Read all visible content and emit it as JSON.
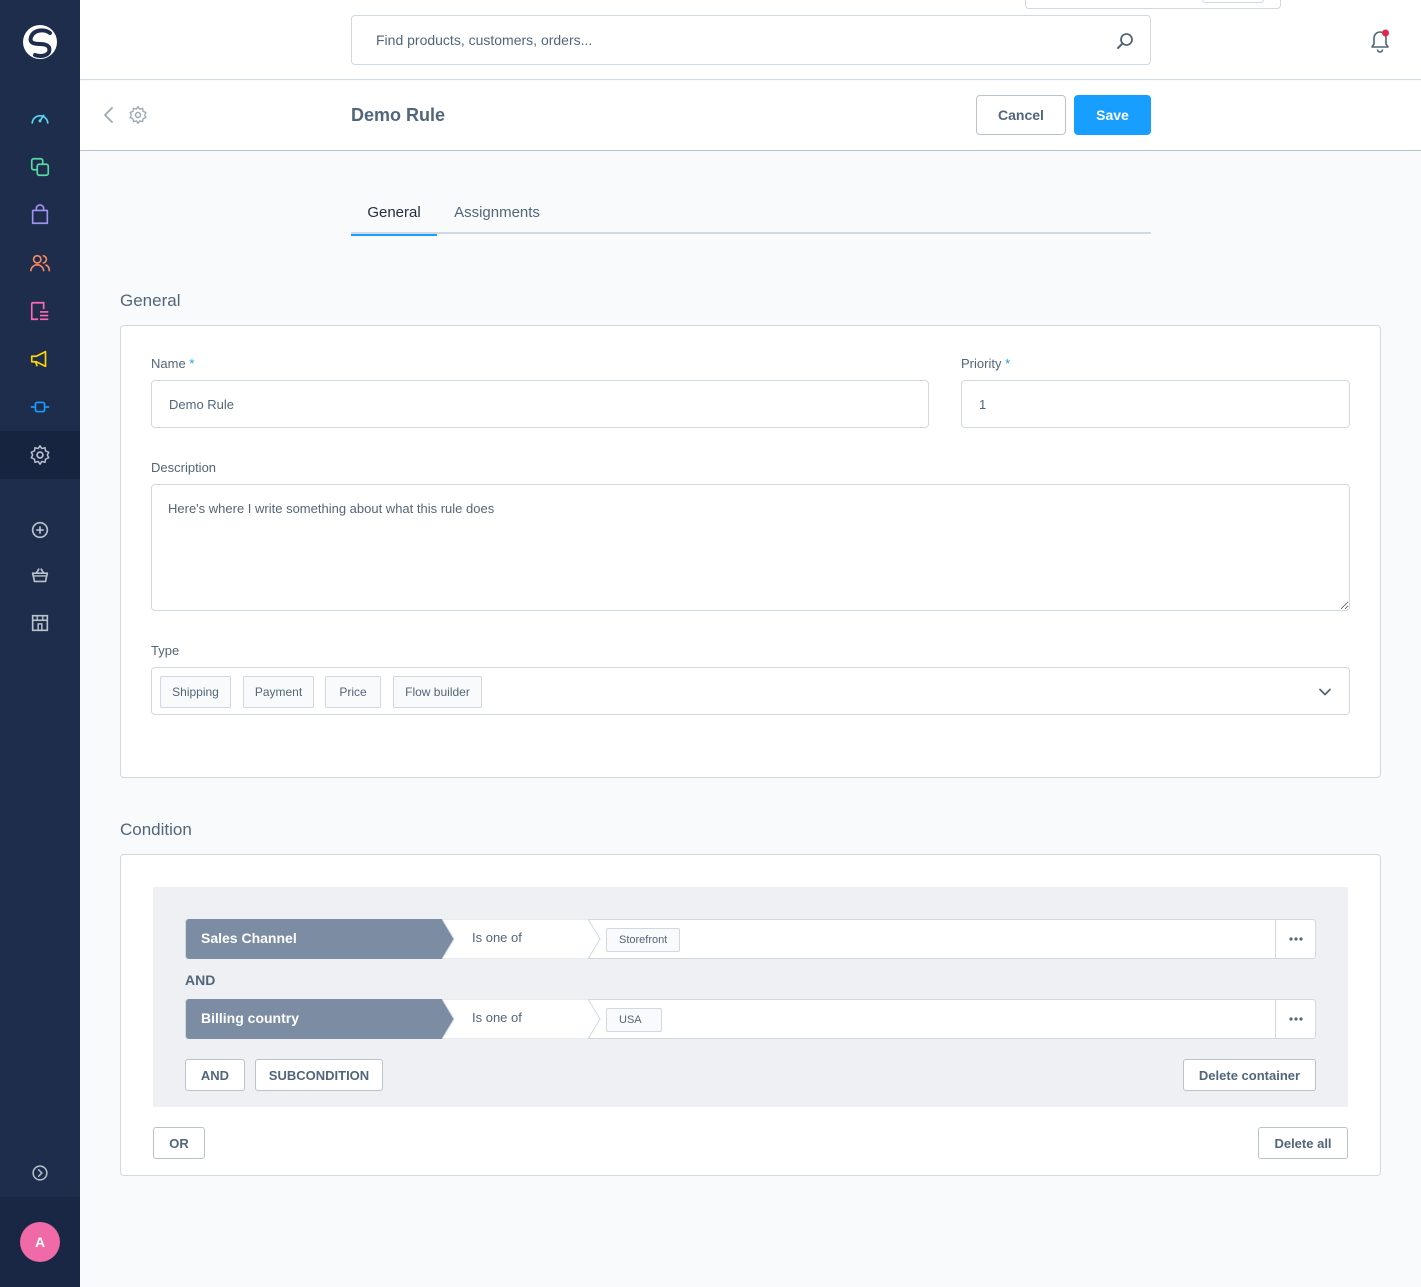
{
  "header": {
    "search_placeholder": "Find products, customers, orders..."
  },
  "smartbar": {
    "title": "Demo Rule",
    "cancel_label": "Cancel",
    "save_label": "Save"
  },
  "tabs": [
    {
      "label": "General",
      "active": true
    },
    {
      "label": "Assignments",
      "active": false
    }
  ],
  "general": {
    "section_title": "General",
    "name_label": "Name",
    "name_value": "Demo Rule",
    "priority_label": "Priority",
    "priority_value": "1",
    "required_marker": "*",
    "description_label": "Description",
    "description_value": "Here's where I write something about what this rule does",
    "type_label": "Type",
    "type_chips": [
      "Shipping",
      "Payment",
      "Price",
      "Flow builder"
    ]
  },
  "condition": {
    "section_title": "Condition",
    "rows": [
      {
        "field": "Sales Channel",
        "operator": "Is one of",
        "value": "Storefront"
      },
      {
        "field": "Billing country",
        "operator": "Is one of",
        "value": "USA"
      }
    ],
    "and_connector": "AND",
    "and_button": "AND",
    "subcondition_button": "SUBCONDITION",
    "delete_container_button": "Delete container",
    "or_button": "OR",
    "delete_all_button": "Delete all"
  },
  "user": {
    "avatar_initial": "A"
  },
  "colors": {
    "sidebar_bg": "#1f2d4d",
    "primary": "#189eff",
    "condition_field_bg": "#7b8ca3",
    "avatar_bg": "#ef6aa6",
    "notification_dot": "#de294c"
  },
  "icons": {
    "nav": [
      "dashboard-icon",
      "catalogue-icon",
      "orders-icon",
      "customers-icon",
      "content-icon",
      "marketing-icon",
      "extensions-icon",
      "settings-icon",
      "add-icon",
      "basket-icon",
      "storefront-icon",
      "expand-icon"
    ]
  }
}
